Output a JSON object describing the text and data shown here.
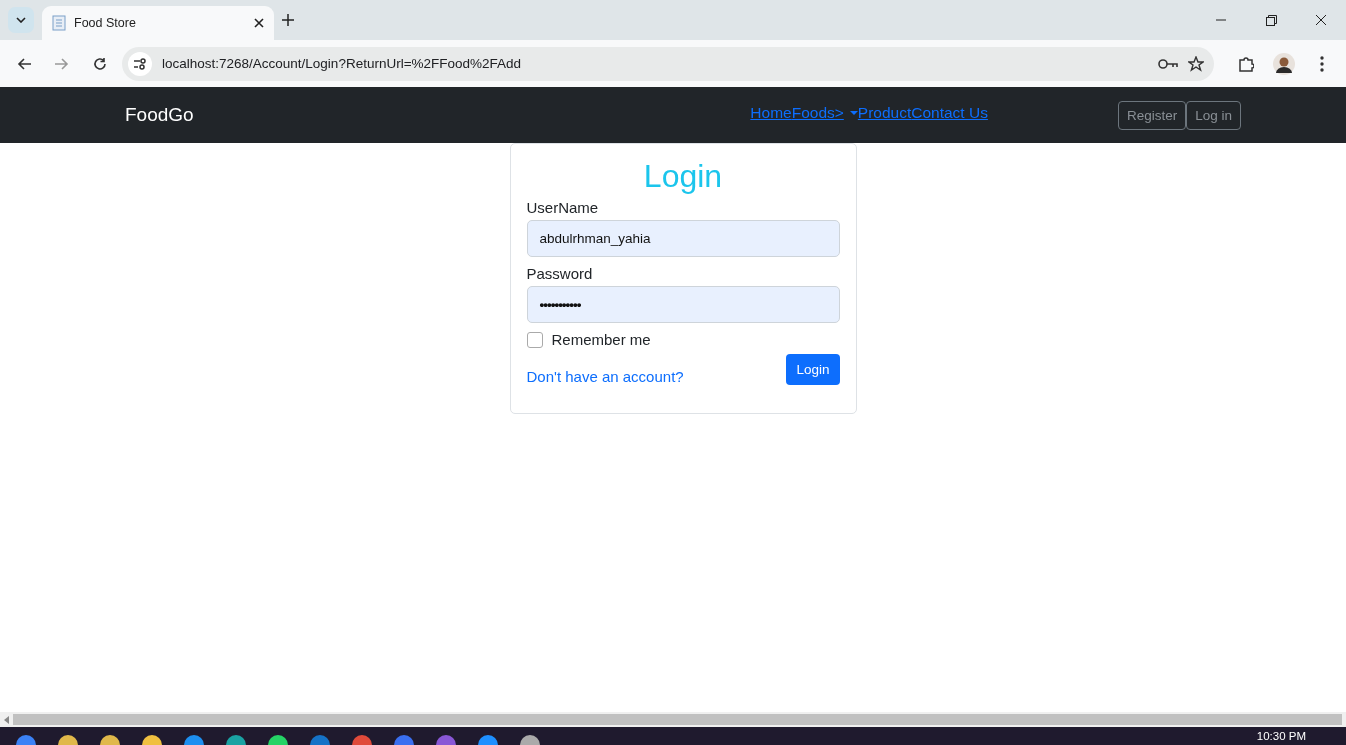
{
  "browser": {
    "tab_title": "Food Store",
    "url": "localhost:7268/Account/Login?ReturnUrl=%2FFood%2FAdd"
  },
  "navbar": {
    "brand": "FoodGo",
    "links": [
      {
        "label": "Home",
        "kind": "link"
      },
      {
        "label": "Foods>",
        "kind": "dropdown"
      },
      {
        "label": "Product",
        "kind": "link"
      },
      {
        "label": "Contact Us",
        "kind": "link"
      }
    ],
    "buttons": [
      "Register",
      "Log in"
    ]
  },
  "form": {
    "title": "Login",
    "fields": [
      {
        "label": "UserName",
        "value": "abdulrhman_yahia",
        "kind": "text"
      },
      {
        "label": "Password",
        "value": "•••••••••••",
        "kind": "password"
      }
    ],
    "remember": {
      "label": "Remember me",
      "checked": false
    },
    "link": "Don't have an account?",
    "submit": "Login"
  },
  "taskbar": {
    "time": "10:30 PM"
  }
}
